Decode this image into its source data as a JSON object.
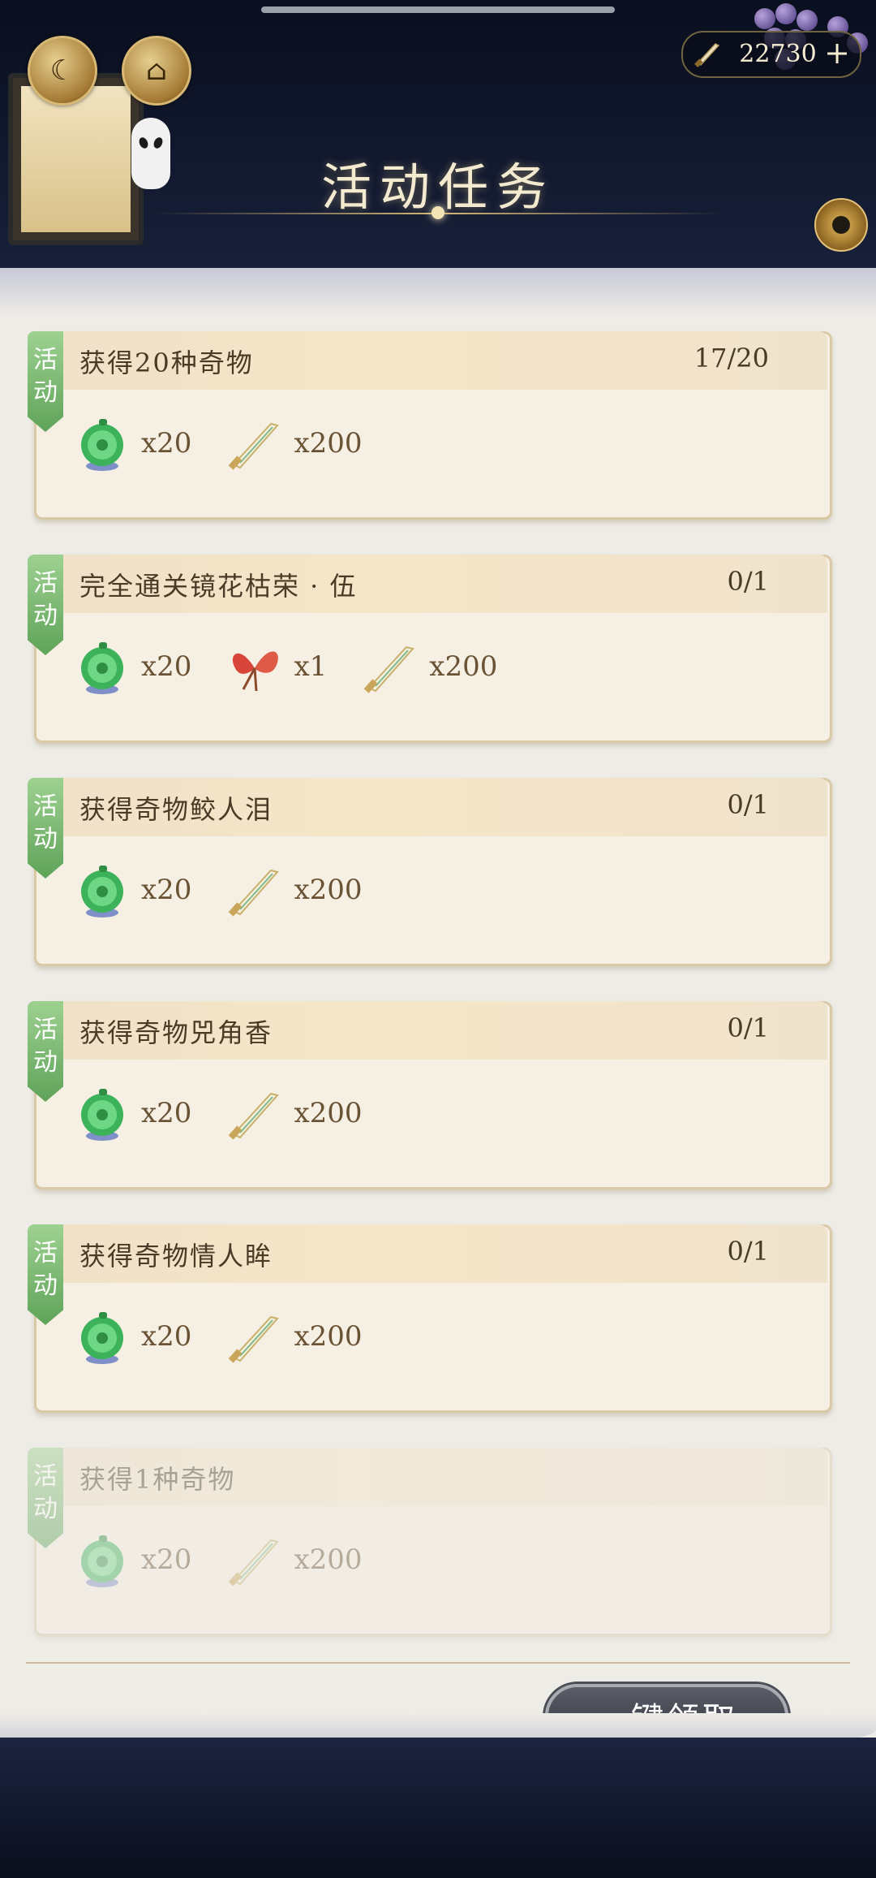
{
  "header": {
    "title": "活动任务",
    "currency_amount": "22730",
    "plus_label": "+",
    "left_buttons": [
      "moon-ship-icon",
      "pavilion-icon"
    ]
  },
  "tasks": [
    {
      "tag": "活动",
      "name": "获得20种奇物",
      "progress": "17/20",
      "enabled": true,
      "rewards": [
        {
          "icon": "jade-icon",
          "qty": "x20"
        },
        {
          "icon": "knife-icon",
          "qty": "x200"
        }
      ]
    },
    {
      "tag": "活动",
      "name": "完全通关镜花枯荣 · 伍",
      "progress": "0/1",
      "enabled": true,
      "rewards": [
        {
          "icon": "jade-icon",
          "qty": "x20"
        },
        {
          "icon": "red-butterfly-icon",
          "qty": "x1"
        },
        {
          "icon": "knife-icon",
          "qty": "x200"
        }
      ]
    },
    {
      "tag": "活动",
      "name": "获得奇物鲛人泪",
      "progress": "0/1",
      "enabled": true,
      "rewards": [
        {
          "icon": "jade-icon",
          "qty": "x20"
        },
        {
          "icon": "knife-icon",
          "qty": "x200"
        }
      ]
    },
    {
      "tag": "活动",
      "name": "获得奇物兕角香",
      "progress": "0/1",
      "enabled": true,
      "rewards": [
        {
          "icon": "jade-icon",
          "qty": "x20"
        },
        {
          "icon": "knife-icon",
          "qty": "x200"
        }
      ]
    },
    {
      "tag": "活动",
      "name": "获得奇物情人眸",
      "progress": "0/1",
      "enabled": true,
      "rewards": [
        {
          "icon": "jade-icon",
          "qty": "x20"
        },
        {
          "icon": "knife-icon",
          "qty": "x200"
        }
      ]
    },
    {
      "tag": "活动",
      "name": "获得1种奇物",
      "progress": "",
      "enabled": false,
      "rewards": [
        {
          "icon": "jade-icon",
          "qty": "x20"
        },
        {
          "icon": "knife-icon",
          "qty": "x200"
        }
      ]
    }
  ],
  "footer": {
    "claim_all_label": "一键领取"
  },
  "colors": {
    "accent_green": "#5fa35a",
    "card_bg": "#f6efe3",
    "text_brown": "#4a3b27"
  }
}
